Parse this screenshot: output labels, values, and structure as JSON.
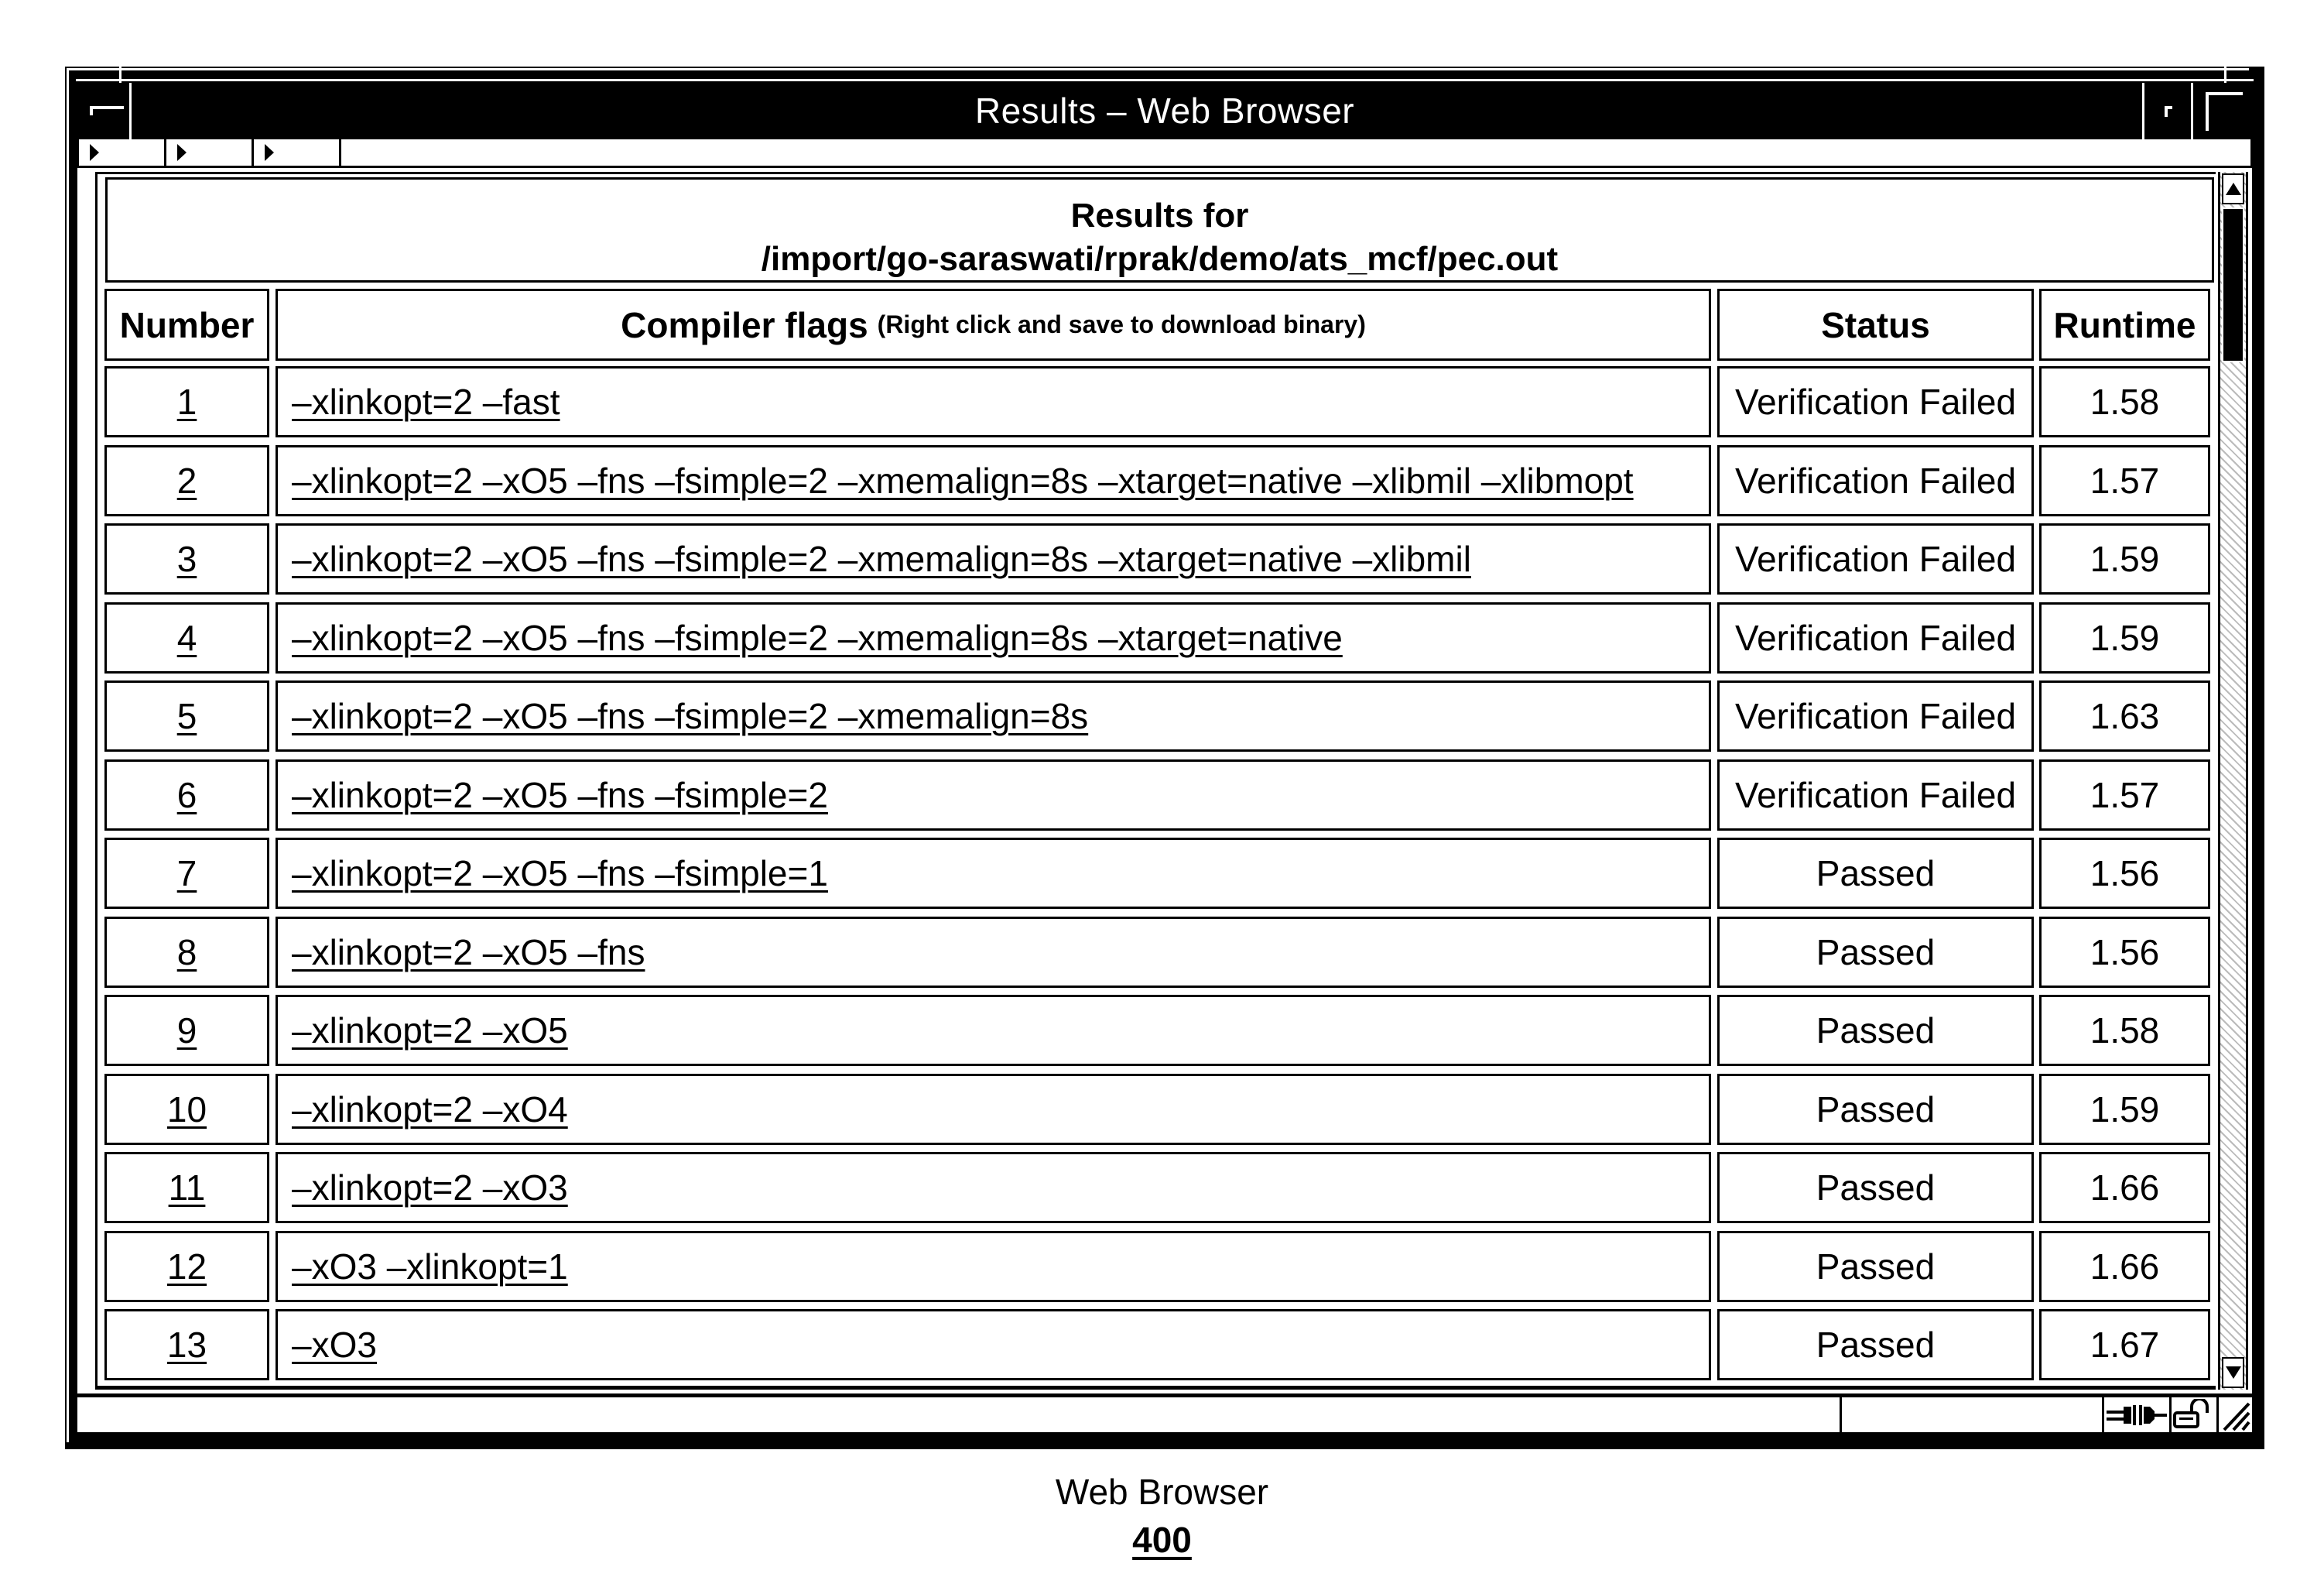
{
  "window": {
    "title": "Results – Web Browser"
  },
  "toolbar": {
    "buttons": [
      {
        "icon": "triangle-right-icon"
      },
      {
        "icon": "triangle-right-icon"
      },
      {
        "icon": "triangle-right-icon"
      }
    ]
  },
  "page": {
    "heading_line1": "Results for",
    "heading_line2": "/import/go-saraswati/rprak/demo/ats_mcf/pec.out"
  },
  "table": {
    "headers": {
      "number": "Number",
      "flags": "Compiler flags",
      "flags_note": "(Right click and save to download binary)",
      "status": "Status",
      "runtime": "Runtime"
    },
    "rows": [
      {
        "number": "1",
        "flags": "–xlinkopt=2 –fast",
        "status": "Verification Failed",
        "runtime": "1.58"
      },
      {
        "number": "2",
        "flags": "–xlinkopt=2 –xO5 –fns –fsimple=2 –xmemalign=8s –xtarget=native –xlibmil –xlibmopt",
        "status": "Verification Failed",
        "runtime": "1.57"
      },
      {
        "number": "3",
        "flags": "–xlinkopt=2 –xO5 –fns –fsimple=2 –xmemalign=8s –xtarget=native –xlibmil",
        "status": "Verification Failed",
        "runtime": "1.59"
      },
      {
        "number": "4",
        "flags": "–xlinkopt=2 –xO5 –fns –fsimple=2 –xmemalign=8s –xtarget=native",
        "status": "Verification Failed",
        "runtime": "1.59"
      },
      {
        "number": "5",
        "flags": "–xlinkopt=2 –xO5 –fns –fsimple=2 –xmemalign=8s",
        "status": "Verification Failed",
        "runtime": "1.63"
      },
      {
        "number": "6",
        "flags": "–xlinkopt=2 –xO5 –fns –fsimple=2",
        "status": "Verification Failed",
        "runtime": "1.57"
      },
      {
        "number": "7",
        "flags": "–xlinkopt=2 –xO5 –fns –fsimple=1",
        "status": "Passed",
        "runtime": "1.56"
      },
      {
        "number": "8",
        "flags": "–xlinkopt=2 –xO5 –fns",
        "status": "Passed",
        "runtime": "1.56"
      },
      {
        "number": "9",
        "flags": "–xlinkopt=2 –xO5",
        "status": "Passed",
        "runtime": "1.58"
      },
      {
        "number": "10",
        "flags": "–xlinkopt=2 –xO4",
        "status": "Passed",
        "runtime": "1.59"
      },
      {
        "number": "11",
        "flags": "–xlinkopt=2 –xO3",
        "status": "Passed",
        "runtime": "1.66"
      },
      {
        "number": "12",
        "flags": "–xO3 –xlinkopt=1",
        "status": "Passed",
        "runtime": "1.66"
      },
      {
        "number": "13",
        "flags": "–xO3",
        "status": "Passed",
        "runtime": "1.67"
      }
    ]
  },
  "statusbar": {
    "icons": [
      "connection-icon",
      "unlocked-padlock-icon",
      "resize-grip-icon"
    ]
  },
  "caption": {
    "title": "Web Browser",
    "ref": "400"
  }
}
